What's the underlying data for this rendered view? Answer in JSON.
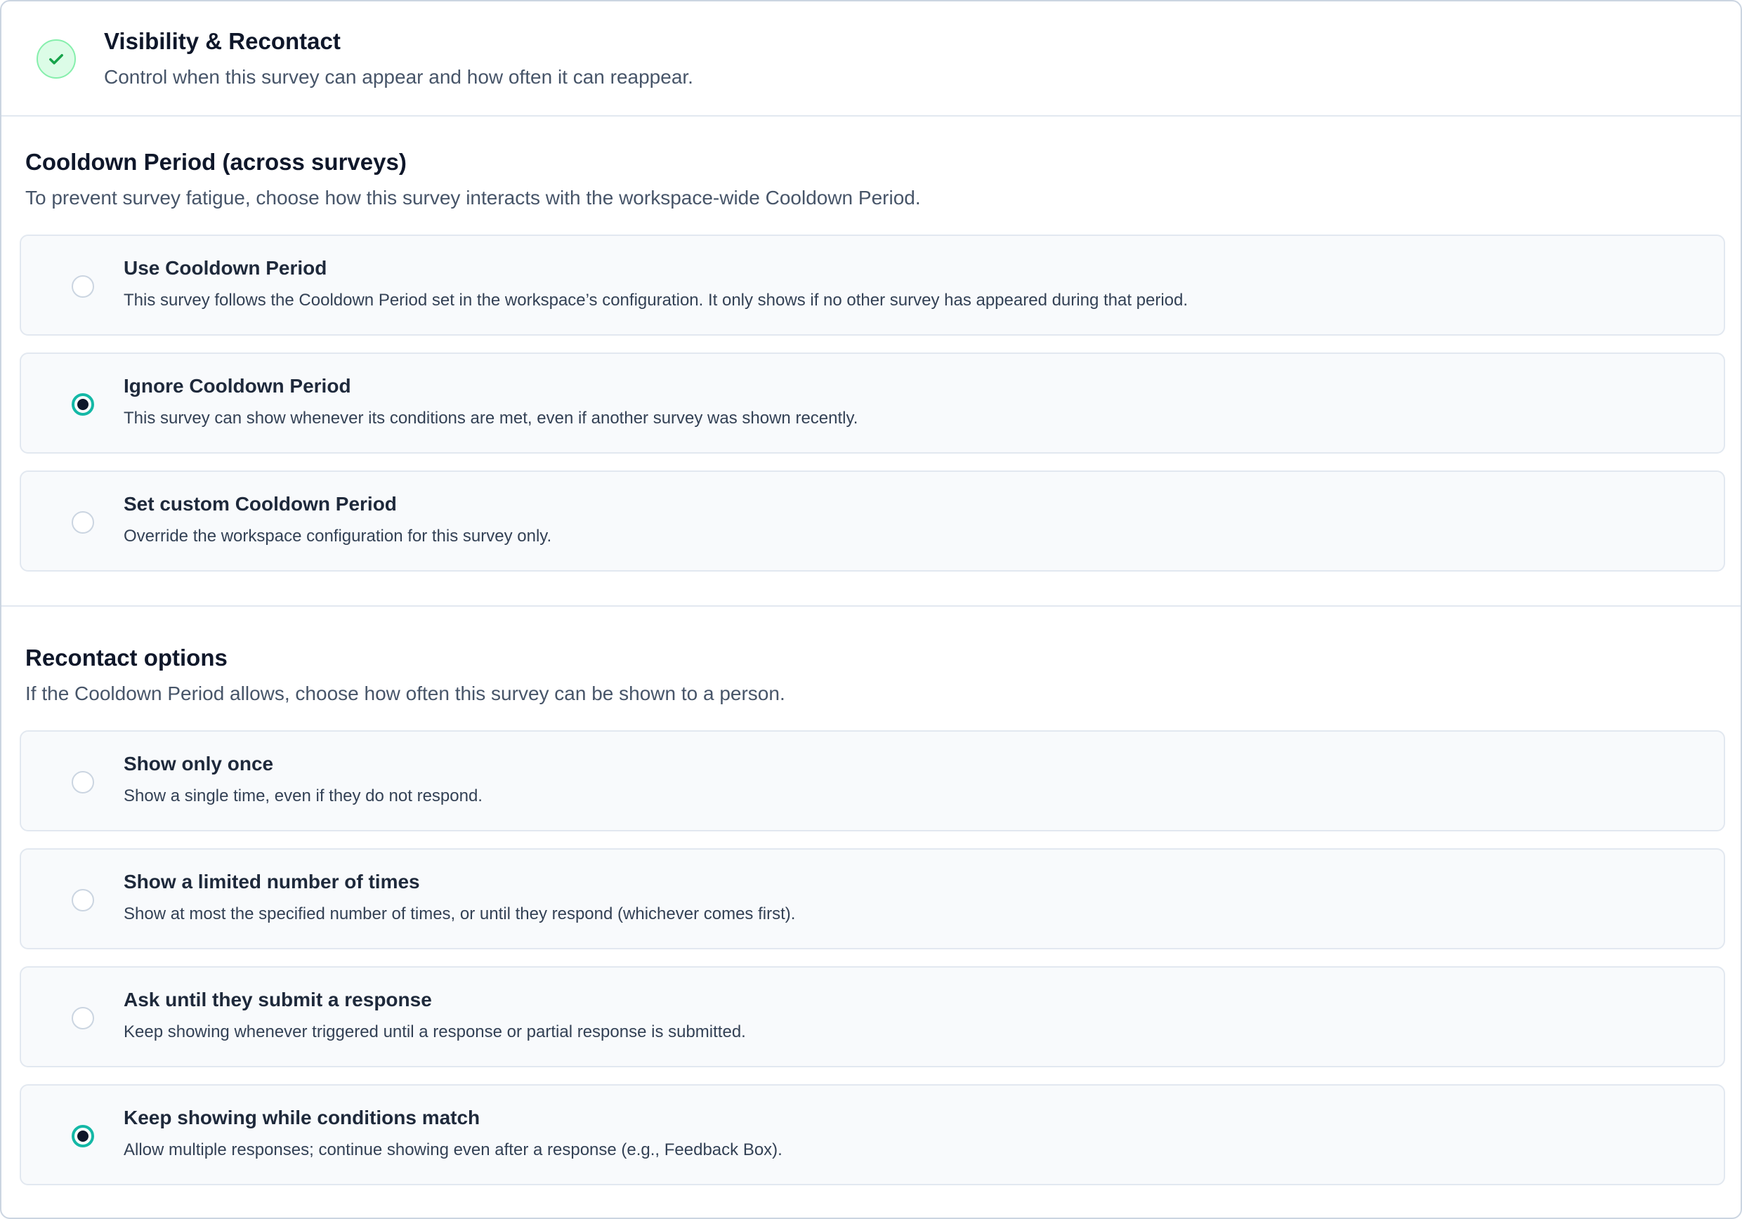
{
  "header": {
    "title": "Visibility & Recontact",
    "subtitle": "Control when this survey can appear and how often it can reappear.",
    "icon": "check-icon",
    "accent_color": "#16a34a"
  },
  "cooldown": {
    "title": "Cooldown Period (across surveys)",
    "subtitle": "To prevent survey fatigue, choose how this survey interacts with the workspace-wide Cooldown Period.",
    "selected": "Ignore Cooldown Period",
    "options": [
      {
        "title": "Use Cooldown Period",
        "description": "This survey follows the Cooldown Period set in the workspace’s configuration. It only shows if no other survey has appeared during that period.",
        "selected": false
      },
      {
        "title": "Ignore Cooldown Period",
        "description": "This survey can show whenever its conditions are met, even if another survey was shown recently.",
        "selected": true
      },
      {
        "title": "Set custom Cooldown Period",
        "description": "Override the workspace configuration for this survey only.",
        "selected": false
      }
    ]
  },
  "recontact": {
    "title": "Recontact options",
    "subtitle": "If the Cooldown Period allows, choose how often this survey can be shown to a person.",
    "selected": "Keep showing while conditions match",
    "options": [
      {
        "title": "Show only once",
        "description": "Show a single time, even if they do not respond.",
        "selected": false
      },
      {
        "title": "Show a limited number of times",
        "description": "Show at most the specified number of times, or until they respond (whichever comes first).",
        "selected": false
      },
      {
        "title": "Ask until they submit a response",
        "description": "Keep showing whenever triggered until a response or partial response is submitted.",
        "selected": false
      },
      {
        "title": "Keep showing while conditions match",
        "description": "Allow multiple responses; continue showing even after a response (e.g., Feedback Box).",
        "selected": true
      }
    ]
  },
  "colors": {
    "radio_selected_ring": "#14b8a6",
    "radio_selected_dot": "#0f172a",
    "card_border": "#cbd5e1",
    "option_background": "#f8fafc"
  }
}
